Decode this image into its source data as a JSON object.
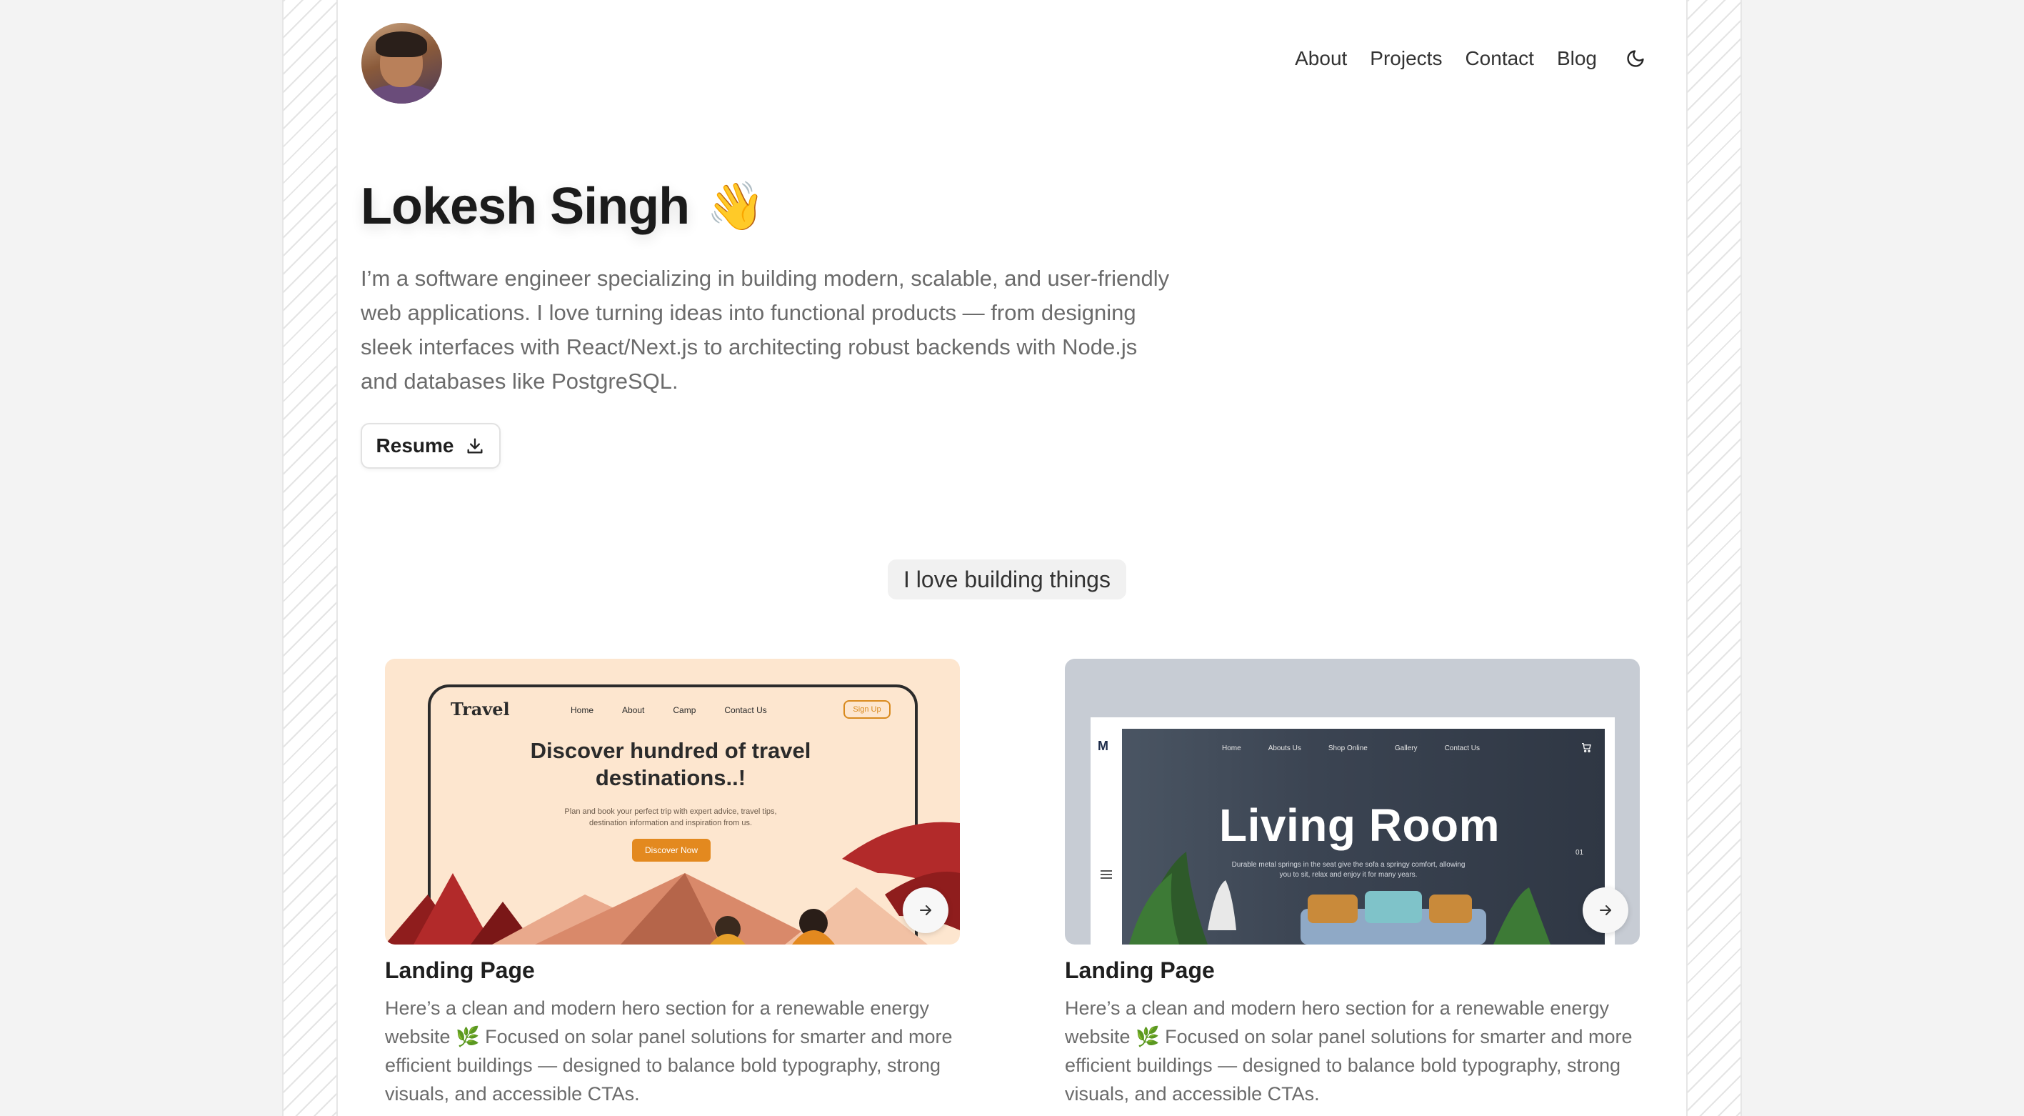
{
  "header": {
    "avatar_alt": "Profile photo of Lokesh Singh",
    "nav": [
      {
        "label": "About"
      },
      {
        "label": "Projects"
      },
      {
        "label": "Contact"
      },
      {
        "label": "Blog"
      }
    ],
    "theme_icon": "moon-icon"
  },
  "hero": {
    "name": "Lokesh Singh",
    "emoji": "👋",
    "bio": "I’m a software engineer specializing in building modern, scalable, and user-friendly web applications. I love turning ideas into functional products — from designing sleek interfaces with React/Next.js to architecting robust backends with Node.js and databases like PostgreSQL.",
    "resume_label": "Resume",
    "resume_icon": "download-icon"
  },
  "section": {
    "pill": "I love building things"
  },
  "projects": [
    {
      "title": "Landing Page",
      "description": "Here’s a clean and modern hero section for a renewable energy website 🌿 Focused on solar panel solutions for smarter and more efficient buildings — designed to balance bold typography, strong visuals, and accessible CTAs.",
      "thumb": {
        "logo": "Travel",
        "nav": [
          "Home",
          "About",
          "Camp",
          "Contact Us"
        ],
        "signup": "Sign Up",
        "headline": "Discover hundred of travel destinations..!",
        "sub": "Plan and book your perfect trip with expert advice, travel tips, destination information and inspiration from us.",
        "cta": "Discover Now"
      }
    },
    {
      "title": "Landing Page",
      "description": "Here’s a clean and modern hero section for a renewable energy website 🌿 Focused on solar panel solutions for smarter and more efficient buildings — designed to balance bold typography, strong visuals, and accessible CTAs.",
      "thumb": {
        "brand": "M",
        "nav": [
          "Home",
          "Abouts Us",
          "Shop Online",
          "Gallery",
          "Contact Us"
        ],
        "headline": "Living Room",
        "caption": "Durable metal springs in the seat give the sofa a springy comfort, allowing you to sit, relax and enjoy it for many years.",
        "counter": "01"
      }
    }
  ],
  "colors": {
    "page_bg": "#f3f3f3",
    "text": "#1f1f1f",
    "muted": "#6b6b6b",
    "travel_bg": "#fde6cf",
    "travel_accent": "#e3891f",
    "living_bg": "#c7ccd4"
  }
}
